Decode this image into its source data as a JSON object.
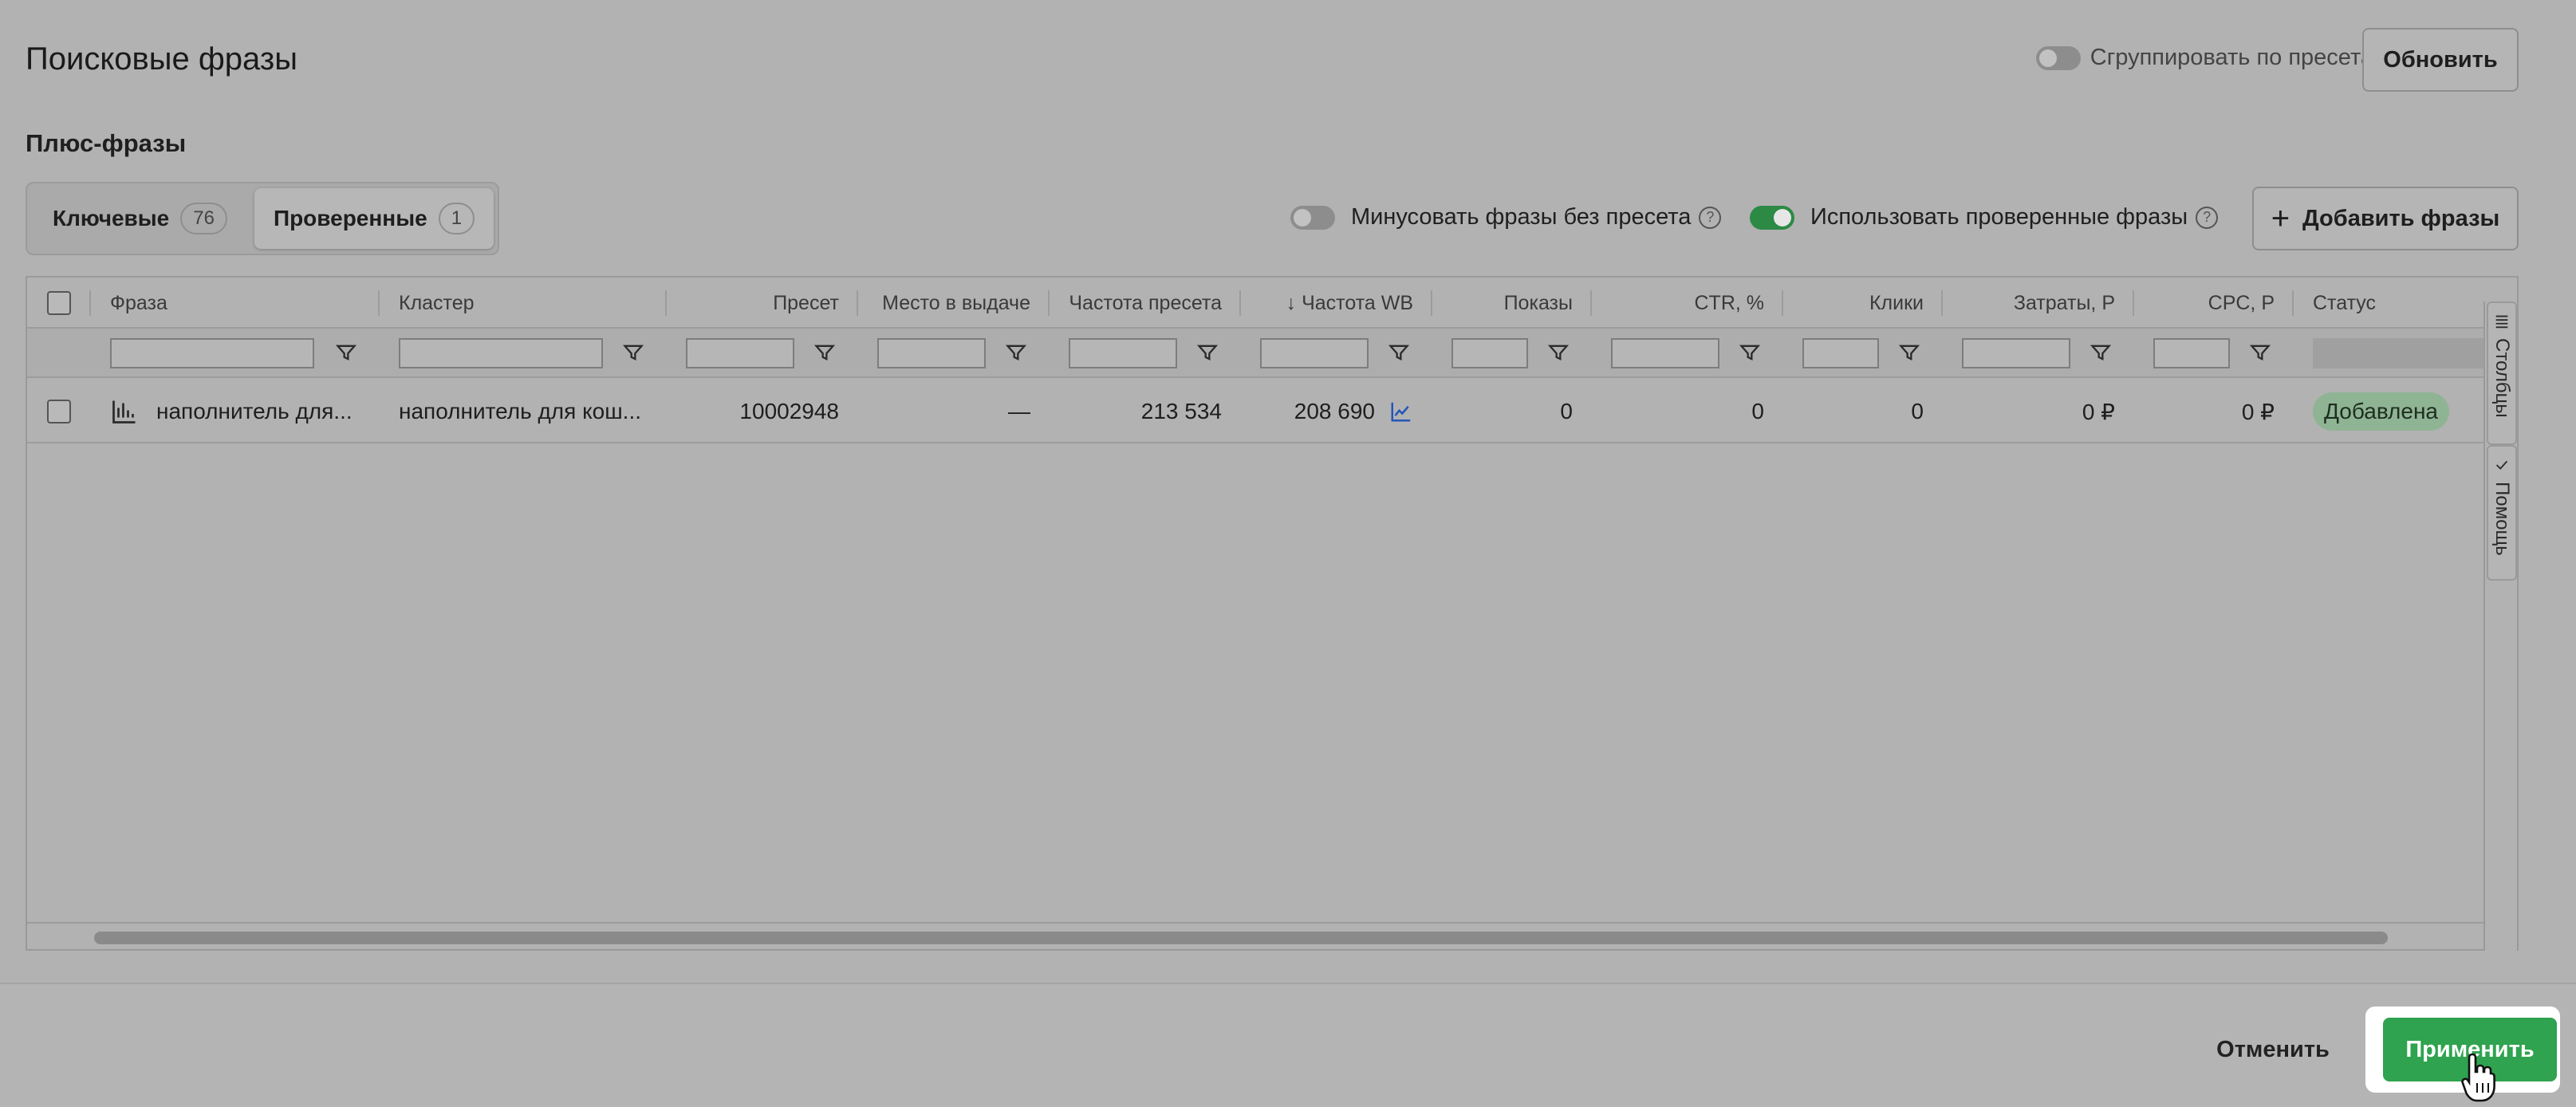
{
  "header": {
    "title": "Поисковые фразы",
    "group_toggle_label": "Сгруппировать по пресетам",
    "refresh_label": "Обновить"
  },
  "section": {
    "title": "Плюс-фразы"
  },
  "tabs": [
    {
      "label": "Ключевые",
      "count": "76",
      "active": false
    },
    {
      "label": "Проверенные",
      "count": "1",
      "active": true
    }
  ],
  "options": {
    "minus_label": "Минусовать фразы без пресета",
    "minus_on": false,
    "verified_label": "Использовать проверенные фразы",
    "verified_on": true,
    "help_symbol": "?",
    "add_label": "Добавить фразы",
    "add_symbol": "+"
  },
  "table": {
    "columns": [
      "Фраза",
      "Кластер",
      "Пресет",
      "Место в выдаче",
      "Частота пресета",
      "↓ Частота WB",
      "Показы",
      "CTR, %",
      "Клики",
      "Затраты, Р",
      "CPC, Р",
      "Статус"
    ],
    "rows": [
      {
        "phrase": "наполнитель для...",
        "cluster": "наполнитель для кош...",
        "preset": "10002948",
        "place": "—",
        "preset_freq": "213 534",
        "wb_freq": "208 690",
        "shows": "0",
        "ctr": "0",
        "clicks": "0",
        "cost": "0 ₽",
        "cpc": "0 ₽",
        "status": "Добавлена"
      }
    ],
    "side_tabs": {
      "columns_label": "Столбцы",
      "help_label": "Помощь"
    }
  },
  "footer": {
    "cancel_label": "Отменить",
    "apply_label": "Применить"
  },
  "colors": {
    "accent_green": "#2fa34f",
    "status_badge": "#8fb494",
    "overlay_gray": "#b2b2b2"
  }
}
